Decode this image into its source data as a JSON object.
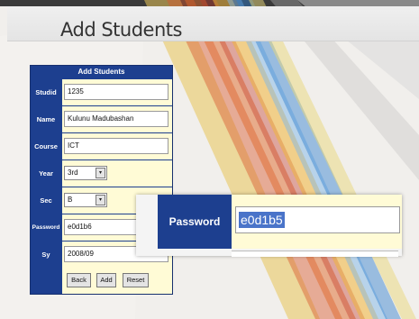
{
  "page": {
    "title": "Add Students"
  },
  "form": {
    "title": "Add Students",
    "fields": [
      {
        "label": "Studid",
        "value": "1235"
      },
      {
        "label": "Name",
        "value": "Kulunu Madubashan"
      },
      {
        "label": "Course",
        "value": "ICT"
      },
      {
        "label": "Year",
        "value": "3rd"
      },
      {
        "label": "Sec",
        "value": "B"
      },
      {
        "label": "Password",
        "value": "e0d1b6"
      },
      {
        "label": "Sy",
        "value": "2008/09"
      }
    ],
    "buttons": {
      "back": "Back",
      "add": "Add",
      "reset": "Reset"
    },
    "select_arrow": "▾"
  },
  "zoom": {
    "label": "Password",
    "value": "e0d1b5"
  },
  "colors": {
    "label_bg": "#1d3f8f",
    "cell_bg": "#fffbd6",
    "selection": "#4a74c9"
  }
}
